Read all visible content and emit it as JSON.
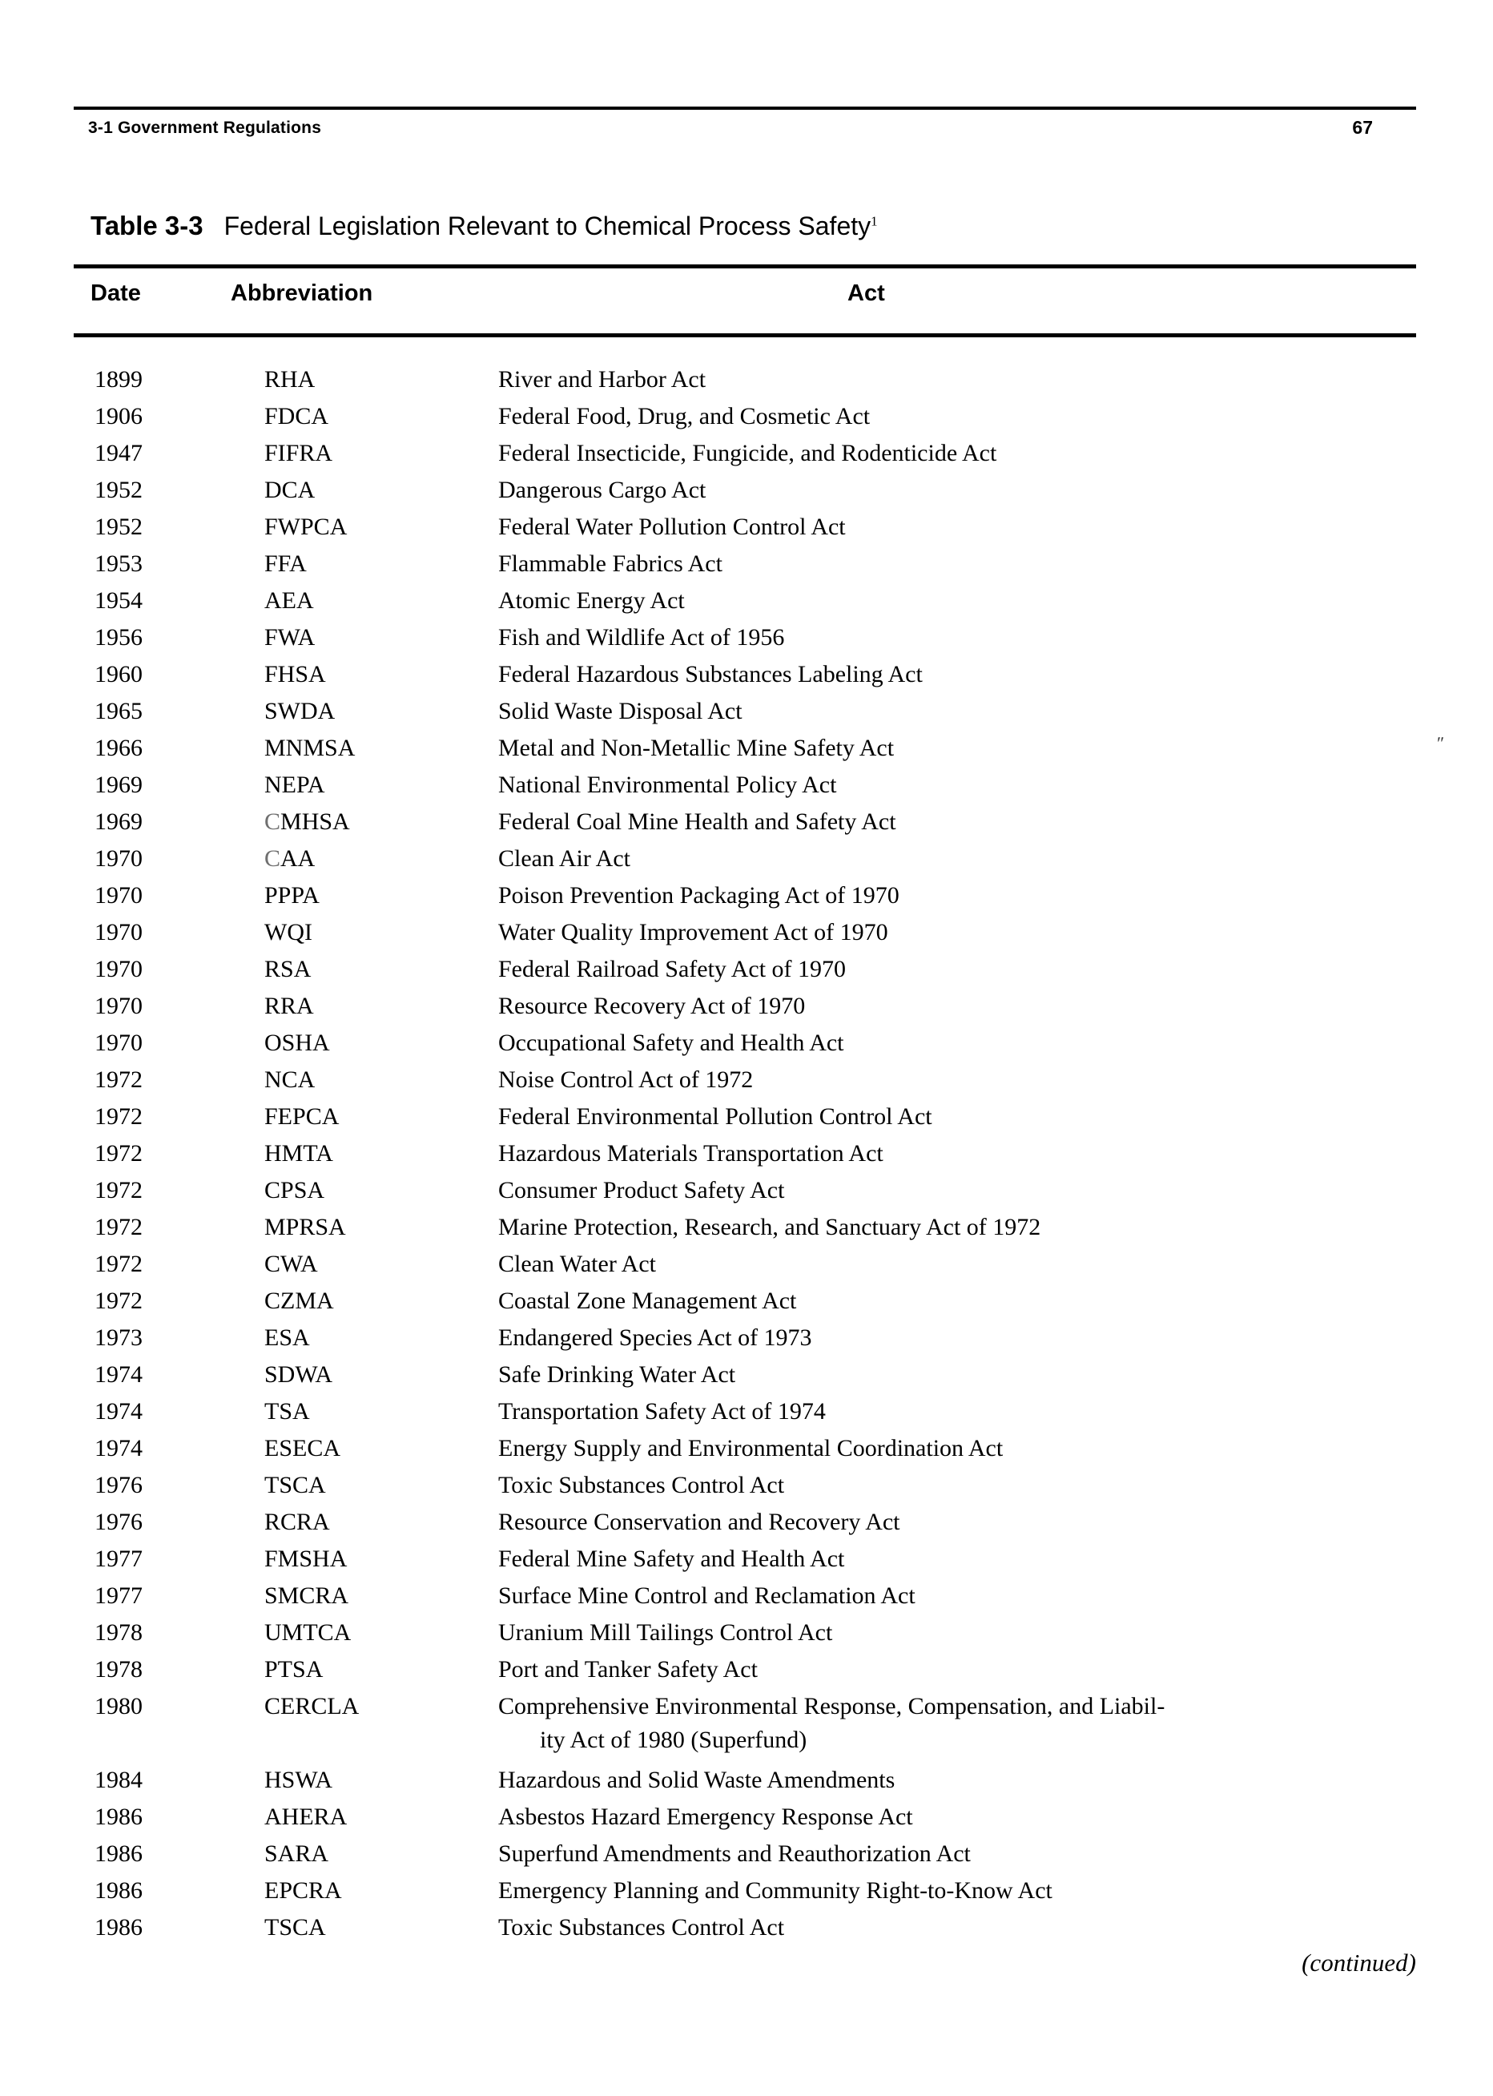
{
  "header": {
    "running_head": "3-1  Government Regulations",
    "page_number": "67"
  },
  "caption": {
    "label": "Table 3-3",
    "title": "Federal Legislation Relevant to Chemical Process Safety",
    "footnote_marker": "1"
  },
  "columns": {
    "date": "Date",
    "abbreviation": "Abbreviation",
    "act": "Act"
  },
  "footer": {
    "continued": "(continued)"
  },
  "rows": [
    {
      "date": "1899",
      "abbr": "RHA",
      "act": "River and Harbor Act"
    },
    {
      "date": "1906",
      "abbr": "FDCA",
      "act": "Federal Food, Drug, and Cosmetic Act"
    },
    {
      "date": "1947",
      "abbr": "FIFRA",
      "act": "Federal Insecticide, Fungicide, and Rodenticide Act"
    },
    {
      "date": "1952",
      "abbr": "DCA",
      "act": "Dangerous Cargo Act"
    },
    {
      "date": "1952",
      "abbr": "FWPCA",
      "act": "Federal Water Pollution Control Act"
    },
    {
      "date": "1953",
      "abbr": "FFA",
      "act": "Flammable Fabrics Act"
    },
    {
      "date": "1954",
      "abbr": "AEA",
      "act": "Atomic Energy Act"
    },
    {
      "date": "1956",
      "abbr": "FWA",
      "act": "Fish and Wildlife Act of 1956"
    },
    {
      "date": "1960",
      "abbr": "FHSA",
      "act": "Federal Hazardous Substances Labeling Act"
    },
    {
      "date": "1965",
      "abbr": "SWDA",
      "act": "Solid Waste Disposal Act"
    },
    {
      "date": "1966",
      "abbr": "MNMSA",
      "act": "Metal and Non-Metallic Mine Safety Act"
    },
    {
      "date": "1969",
      "abbr": "NEPA",
      "act": "National Environmental Policy Act"
    },
    {
      "date": "1969",
      "abbr": "CMHSA",
      "act": "Federal Coal Mine Health and Safety Act"
    },
    {
      "date": "1970",
      "abbr": "CAA",
      "act": "Clean Air Act"
    },
    {
      "date": "1970",
      "abbr": "PPPA",
      "act": "Poison Prevention Packaging Act of 1970"
    },
    {
      "date": "1970",
      "abbr": "WQI",
      "act": "Water Quality Improvement Act of 1970"
    },
    {
      "date": "1970",
      "abbr": "RSA",
      "act": "Federal Railroad Safety Act of 1970"
    },
    {
      "date": "1970",
      "abbr": "RRA",
      "act": "Resource Recovery Act of 1970"
    },
    {
      "date": "1970",
      "abbr": "OSHA",
      "act": "Occupational Safety and Health Act"
    },
    {
      "date": "1972",
      "abbr": "NCA",
      "act": "Noise Control Act of 1972"
    },
    {
      "date": "1972",
      "abbr": "FEPCA",
      "act": "Federal Environmental Pollution Control Act"
    },
    {
      "date": "1972",
      "abbr": "HMTA",
      "act": "Hazardous Materials Transportation Act"
    },
    {
      "date": "1972",
      "abbr": "CPSA",
      "act": "Consumer Product Safety Act"
    },
    {
      "date": "1972",
      "abbr": "MPRSA",
      "act": "Marine Protection, Research, and Sanctuary Act of 1972"
    },
    {
      "date": "1972",
      "abbr": "CWA",
      "act": "Clean Water Act"
    },
    {
      "date": "1972",
      "abbr": "CZMA",
      "act": "Coastal Zone Management Act"
    },
    {
      "date": "1973",
      "abbr": "ESA",
      "act": "Endangered Species Act of 1973"
    },
    {
      "date": "1974",
      "abbr": "SDWA",
      "act": "Safe Drinking Water Act"
    },
    {
      "date": "1974",
      "abbr": "TSA",
      "act": "Transportation Safety Act of 1974"
    },
    {
      "date": "1974",
      "abbr": "ESECA",
      "act": "Energy Supply and Environmental Coordination Act"
    },
    {
      "date": "1976",
      "abbr": "TSCA",
      "act": "Toxic Substances Control Act"
    },
    {
      "date": "1976",
      "abbr": "RCRA",
      "act": "Resource Conservation and Recovery Act"
    },
    {
      "date": "1977",
      "abbr": "FMSHA",
      "act": "Federal Mine Safety and Health Act"
    },
    {
      "date": "1977",
      "abbr": "SMCRA",
      "act": "Surface Mine Control and Reclamation Act"
    },
    {
      "date": "1978",
      "abbr": "UMTCA",
      "act": "Uranium Mill Tailings Control Act"
    },
    {
      "date": "1978",
      "abbr": "PTSA",
      "act": "Port and Tanker Safety Act"
    },
    {
      "date": "1980",
      "abbr": "CERCLA",
      "act": "Comprehensive Environmental Response, Compensation, and Liabil-",
      "act_cont": "ity Act of 1980 (Superfund)"
    },
    {
      "date": "1984",
      "abbr": "HSWA",
      "act": "Hazardous and Solid Waste Amendments"
    },
    {
      "date": "1986",
      "abbr": "AHERA",
      "act": "Asbestos Hazard Emergency Response Act"
    },
    {
      "date": "1986",
      "abbr": "SARA",
      "act": "Superfund Amendments and Reauthorization Act"
    },
    {
      "date": "1986",
      "abbr": "EPCRA",
      "act": "Emergency Planning and Community Right-to-Know Act"
    },
    {
      "date": "1986",
      "abbr": "TSCA",
      "act": "Toxic Substances Control Act"
    }
  ]
}
